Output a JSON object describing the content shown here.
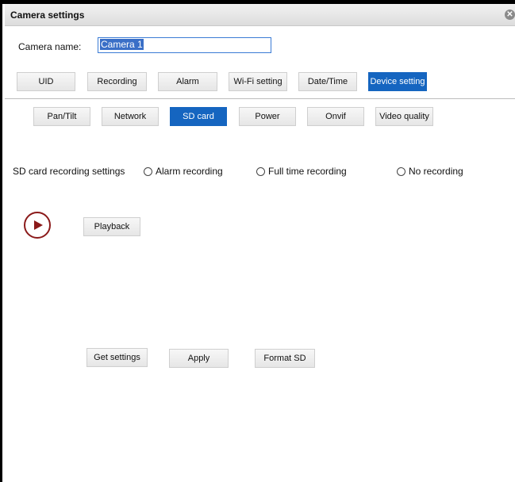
{
  "window": {
    "title": "Camera settings",
    "close_glyph": "✕"
  },
  "camera_name": {
    "label": "Camera name:",
    "value": "Camera 1"
  },
  "main_tabs": [
    {
      "label": "UID",
      "active": false
    },
    {
      "label": "Recording",
      "active": false
    },
    {
      "label": "Alarm",
      "active": false
    },
    {
      "label": "Wi-Fi setting",
      "active": false
    },
    {
      "label": "Date/Time",
      "active": false
    },
    {
      "label": "Device setting",
      "active": true
    }
  ],
  "sub_tabs": [
    {
      "label": "Pan/Tilt",
      "active": false
    },
    {
      "label": "Network",
      "active": false
    },
    {
      "label": "SD card",
      "active": true
    },
    {
      "label": "Power",
      "active": false
    },
    {
      "label": "Onvif",
      "active": false
    },
    {
      "label": "Video quality",
      "active": false
    }
  ],
  "sd_recording": {
    "label": "SD card recording settings",
    "options": [
      "Alarm recording",
      "Full time recording",
      "No recording"
    ]
  },
  "playback": {
    "label": "Playback",
    "icon": "play-icon"
  },
  "actions": {
    "get_settings": "Get settings",
    "apply": "Apply",
    "format_sd": "Format SD"
  },
  "colors": {
    "active_tab": "#1565c0",
    "play_icon": "#8b1a1a",
    "input_border": "#3a7bd5"
  }
}
